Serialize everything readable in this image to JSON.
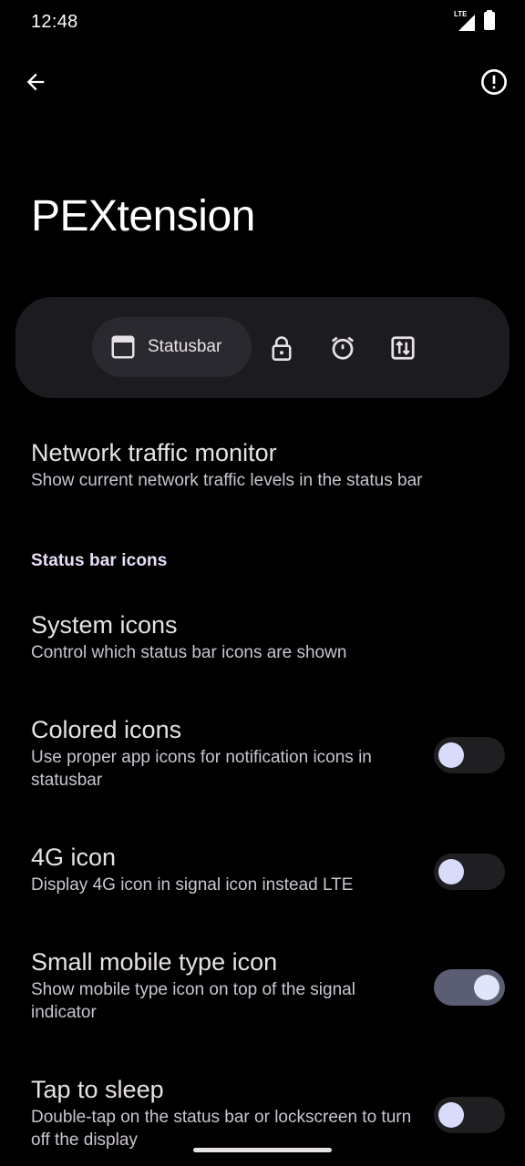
{
  "status_bar": {
    "time": "12:48",
    "network_label": "LTE",
    "icons": [
      "signal-icon",
      "battery-icon"
    ]
  },
  "app_bar": {
    "back_icon": "arrow-back-icon",
    "info_icon": "info-icon"
  },
  "page": {
    "title": "PEXtension"
  },
  "tabs": {
    "active_label": "Statusbar",
    "items": [
      {
        "icon": "browser-window-icon",
        "label": "Statusbar",
        "selected": true
      },
      {
        "icon": "lock-icon",
        "selected": false
      },
      {
        "icon": "alarm-icon",
        "selected": false
      },
      {
        "icon": "swap-vertical-icon",
        "selected": false
      }
    ]
  },
  "prefs": {
    "network_traffic": {
      "title": "Network traffic monitor",
      "summary": "Show current network traffic levels in the status bar"
    },
    "section_header": "Status bar icons",
    "system_icons": {
      "title": "System icons",
      "summary": "Control which status bar icons are shown"
    },
    "colored_icons": {
      "title": "Colored icons",
      "summary": "Use proper app icons for notification icons in statusbar",
      "checked": false
    },
    "fourg_icon": {
      "title": "4G icon",
      "summary": "Display 4G icon in signal icon instead LTE",
      "checked": false
    },
    "small_mobile_type": {
      "title": "Small mobile type icon",
      "summary": "Show mobile type icon on top of the signal indicator",
      "checked": true
    },
    "tap_to_sleep": {
      "title": "Tap to sleep",
      "summary": "Double-tap on the status bar or lockscreen to turn off the display",
      "checked": false
    }
  },
  "colors": {
    "background": "#000000",
    "surface": "#1C1B1F",
    "tab_selected": "#2B2930",
    "switch_on_track": "#5B5D72",
    "switch_knob": "#D8DCFA"
  }
}
